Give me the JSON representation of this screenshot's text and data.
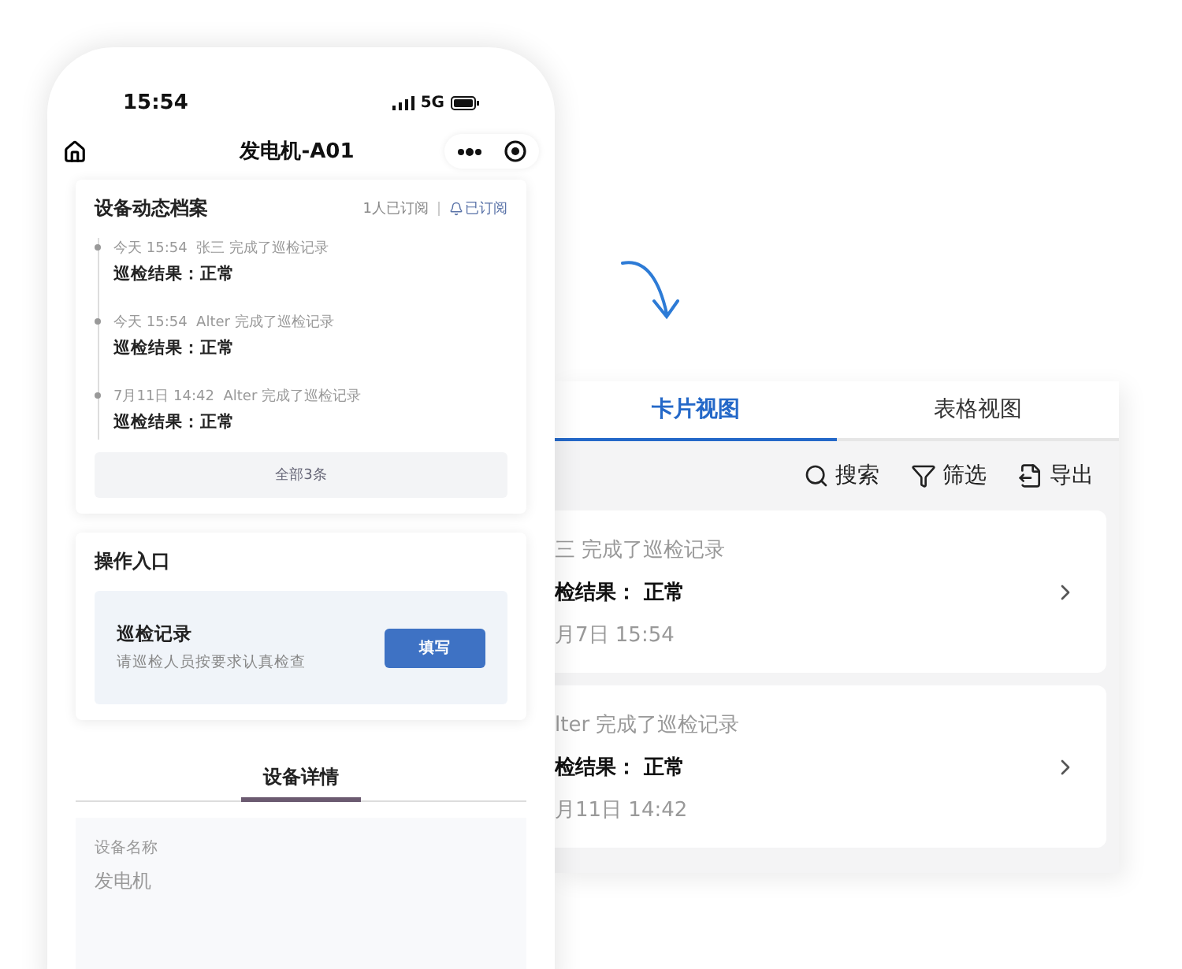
{
  "phone": {
    "status_bar": {
      "time": "15:54",
      "network": "5G"
    },
    "nav": {
      "title": "发电机-A01"
    },
    "archive": {
      "title": "设备动态档案",
      "subscribers": "1人已订阅",
      "subscribe_button": "已订阅",
      "subscribed": true,
      "entries": [
        {
          "time": "今天 15:54",
          "text": "张三 完成了巡检记录",
          "result": "巡检结果：正常"
        },
        {
          "time": "今天 15:54",
          "text": "Alter 完成了巡检记录",
          "result": "巡检结果：正常"
        },
        {
          "time": "7月11日 14:42",
          "text": "Alter 完成了巡检记录",
          "result": "巡检结果：正常"
        }
      ],
      "all_button": "全部3条"
    },
    "actions": {
      "title": "操作入口",
      "item": {
        "title": "巡检记录",
        "hint": "请巡检人员按要求认真检查",
        "button": "填写"
      }
    },
    "detail_tabs": [
      {
        "label": "设备详情",
        "selected": true
      }
    ],
    "detail": {
      "label": "设备名称",
      "value": "发电机"
    }
  },
  "panel": {
    "tabs": [
      {
        "label": "卡片视图",
        "selected": true
      },
      {
        "label": "表格视图",
        "selected": false
      }
    ],
    "toolbar": [
      {
        "kind": "search",
        "label": "搜索"
      },
      {
        "kind": "filter",
        "label": "筛选"
      },
      {
        "kind": "export",
        "label": "导出"
      }
    ],
    "cards": [
      {
        "line1": "三 完成了巡检记录",
        "result": "检结果：",
        "status": "正常",
        "date": "月7日 15:54"
      },
      {
        "line1": "lter 完成了巡检记录",
        "result": "检结果：",
        "status": "正常",
        "date": "月11日 14:42"
      }
    ]
  }
}
